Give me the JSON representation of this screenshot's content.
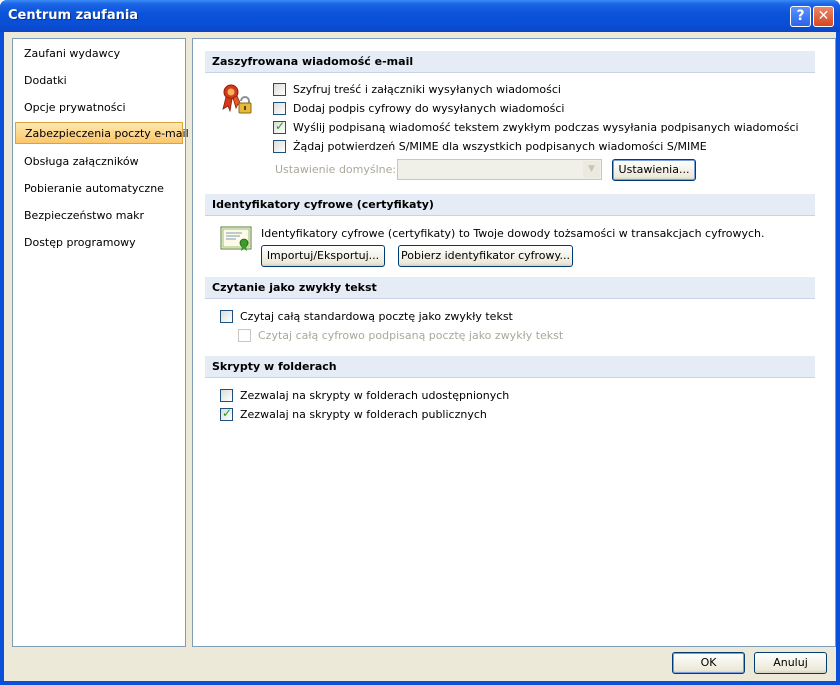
{
  "window": {
    "title": "Centrum zaufania",
    "help_label": "?",
    "close_label": "✕"
  },
  "nav": {
    "items": [
      {
        "label": "Zaufani wydawcy",
        "selected": false
      },
      {
        "label": "Dodatki",
        "selected": false
      },
      {
        "label": "Opcje prywatności",
        "selected": false
      },
      {
        "label": "Zabezpieczenia poczty e-mail",
        "selected": true
      },
      {
        "label": "Obsługa załączników",
        "selected": false
      },
      {
        "label": "Pobieranie automatyczne",
        "selected": false
      },
      {
        "label": "Bezpieczeństwo makr",
        "selected": false
      },
      {
        "label": "Dostęp programowy",
        "selected": false
      }
    ]
  },
  "encrypted": {
    "header": "Zaszyfrowana wiadomość e-mail",
    "icon": "certificate-lock-icon",
    "options": [
      {
        "label": "Szyfruj treść i załączniki wysyłanych wiadomości",
        "checked": false
      },
      {
        "label": "Dodaj podpis cyfrowy do wysyłanych wiadomości",
        "checked": false
      },
      {
        "label": "Wyślij podpisaną wiadomość tekstem zwykłym podczas wysyłania podpisanych wiadomości",
        "checked": true
      },
      {
        "label": "Żądaj potwierdzeń S/MIME dla wszystkich podpisanych wiadomości S/MIME",
        "checked": false
      }
    ],
    "default_setting_label": "Ustawienie domyślne:",
    "default_setting_value": "",
    "settings_button": "Ustawienia..."
  },
  "digital_ids": {
    "header": "Identyfikatory cyfrowe (certyfikaty)",
    "icon": "certificate-icon",
    "description": "Identyfikatory cyfrowe (certyfikaty) to Twoje dowody tożsamości w transakcjach cyfrowych.",
    "import_export_button": "Importuj/Eksportuj...",
    "get_id_button": "Pobierz identyfikator cyfrowy..."
  },
  "plain_text": {
    "header": "Czytanie jako zwykły tekst",
    "options": [
      {
        "label": "Czytaj całą standardową pocztę jako zwykły tekst",
        "checked": false,
        "disabled": false
      },
      {
        "label": "Czytaj całą cyfrowo podpisaną pocztę jako zwykły tekst",
        "checked": false,
        "disabled": true
      }
    ]
  },
  "scripts": {
    "header": "Skrypty w folderach",
    "options": [
      {
        "label": "Zezwalaj na skrypty w folderach udostępnionych",
        "checked": false
      },
      {
        "label": "Zezwalaj na skrypty w folderach publicznych",
        "checked": true
      }
    ]
  },
  "footer": {
    "ok_button": "OK",
    "cancel_button": "Anuluj"
  }
}
